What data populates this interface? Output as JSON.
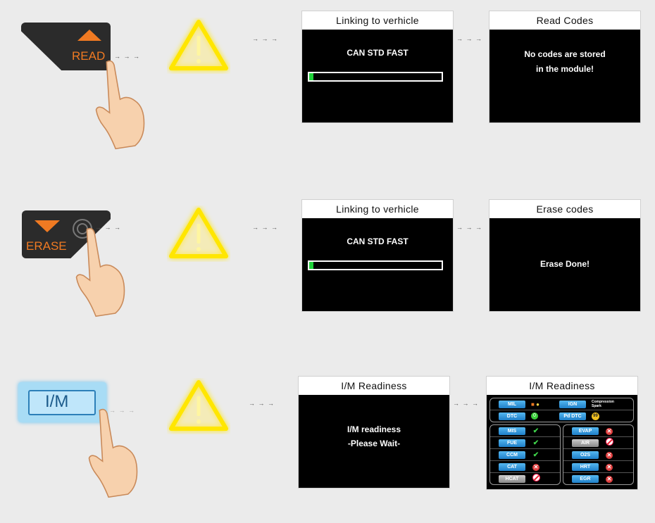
{
  "rows": [
    {
      "button": {
        "label": "READ",
        "icon": "triangle-up-icon"
      },
      "screen1": {
        "title": "Linking to verhicle",
        "line1": "CAN STD FAST",
        "progress_percent": 2
      },
      "screen2": {
        "title": "Read Codes",
        "line1": "No codes are stored",
        "line2": "in the module!"
      }
    },
    {
      "button": {
        "label": "ERASE",
        "icon": "triangle-down-icon"
      },
      "screen1": {
        "title": "Linking to verhicle",
        "line1": "CAN STD FAST",
        "progress_percent": 2
      },
      "screen2": {
        "title": "Erase codes",
        "line1": "Erase Done!"
      }
    },
    {
      "button": {
        "label": "I/M"
      },
      "screen1": {
        "title": "I/M Readiness",
        "line1": "I/M readiness",
        "line2": "-Please Wait-"
      },
      "screen2": {
        "title": "I/M Readiness"
      }
    }
  ],
  "arrow_text": "→ → →",
  "colors": {
    "accent": "#f07a22",
    "warning": "#ffe600",
    "progress": "#1fd23a",
    "im_button": "#a8dcf5"
  },
  "im_panel": {
    "top": [
      {
        "a": "MIL",
        "a_status": "engine-light-icon",
        "b": "IGN",
        "b_text": "Compression Spark"
      },
      {
        "a": "DTC",
        "a_value": "0",
        "b": "Pd DTC",
        "b_value": "99"
      }
    ],
    "left": [
      {
        "name": "MIS",
        "status": "complete"
      },
      {
        "name": "FUE",
        "status": "complete"
      },
      {
        "name": "CCM",
        "status": "complete"
      },
      {
        "name": "CAT",
        "status": "incomplete"
      },
      {
        "name": "HCAT",
        "status": "not-supported"
      }
    ],
    "right": [
      {
        "name": "EVAP",
        "status": "incomplete"
      },
      {
        "name": "AIR",
        "status": "not-supported"
      },
      {
        "name": "O2S",
        "status": "incomplete"
      },
      {
        "name": "HRT",
        "status": "incomplete"
      },
      {
        "name": "EGR",
        "status": "incomplete"
      }
    ]
  }
}
